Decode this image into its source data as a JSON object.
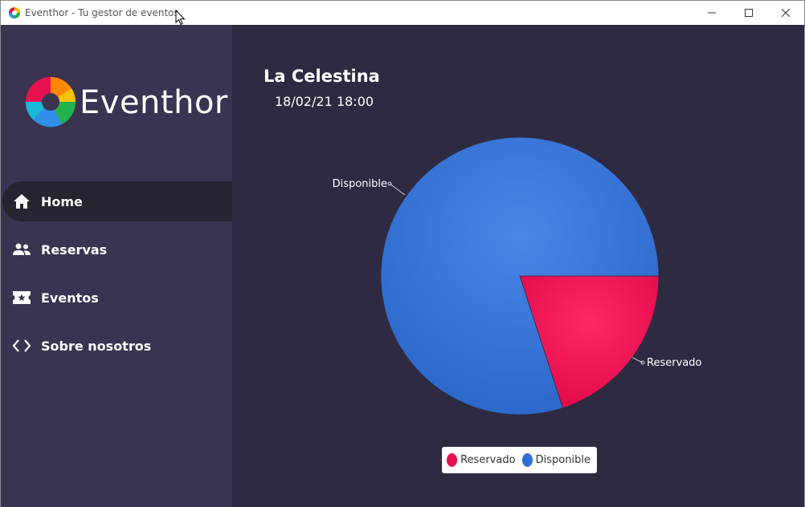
{
  "window": {
    "title": "Eventhor - Tu gestor de eventos"
  },
  "sidebar": {
    "brand": "Eventhor",
    "items": [
      {
        "label": "Home",
        "icon": "home-icon",
        "active": true
      },
      {
        "label": "Reservas",
        "icon": "people-icon",
        "active": false
      },
      {
        "label": "Eventos",
        "icon": "ticket-icon",
        "active": false
      },
      {
        "label": "Sobre nosotros",
        "icon": "code-icon",
        "active": false
      }
    ]
  },
  "event": {
    "name": "La Celestina",
    "datetime": "18/02/21 18:00"
  },
  "colors": {
    "sidebar_bg": "#3a3351",
    "main_bg": "#2e2a41",
    "reservado": "#e8114f",
    "disponible": "#2f6fd4"
  },
  "chart_data": {
    "type": "pie",
    "title": "",
    "slices": [
      {
        "label": "Reservado",
        "value": 20,
        "color": "#e8114f"
      },
      {
        "label": "Disponible",
        "value": 80,
        "color": "#2f6fd4"
      }
    ],
    "legend_position": "bottom"
  }
}
